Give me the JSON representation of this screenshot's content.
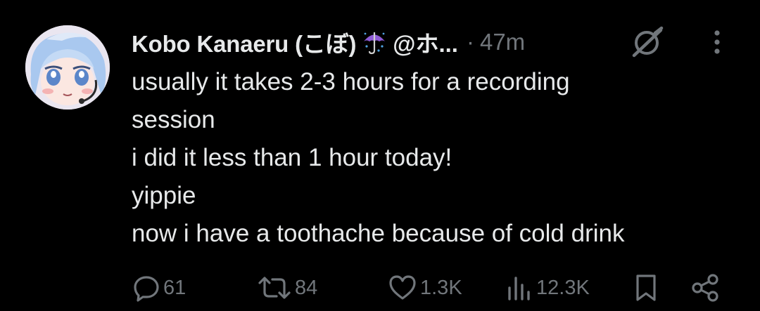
{
  "post": {
    "author": {
      "display_name": "Kobo Kanaeru (こぼ)",
      "handle": "@ホ...",
      "badge_emoji": "umbrella-rain-emoji"
    },
    "separator": "·",
    "timestamp": "47m",
    "lines": [
      "usually it takes 2-3 hours for a recording",
      "session",
      "i did it less than 1 hour today!",
      "yippie",
      "now i have a toothache because of cold drink"
    ],
    "stats": {
      "replies": "61",
      "reposts": "84",
      "likes": "1.3K",
      "views": "12.3K"
    }
  },
  "colors": {
    "background": "#000000",
    "primary_text": "#e7e9ea",
    "secondary_text": "#71767b",
    "umbrella": "#8e5bd6"
  },
  "icons": [
    "grok-icon",
    "more-icon",
    "reply-icon",
    "repost-icon",
    "like-icon",
    "views-icon",
    "bookmark-icon",
    "share-icon"
  ]
}
